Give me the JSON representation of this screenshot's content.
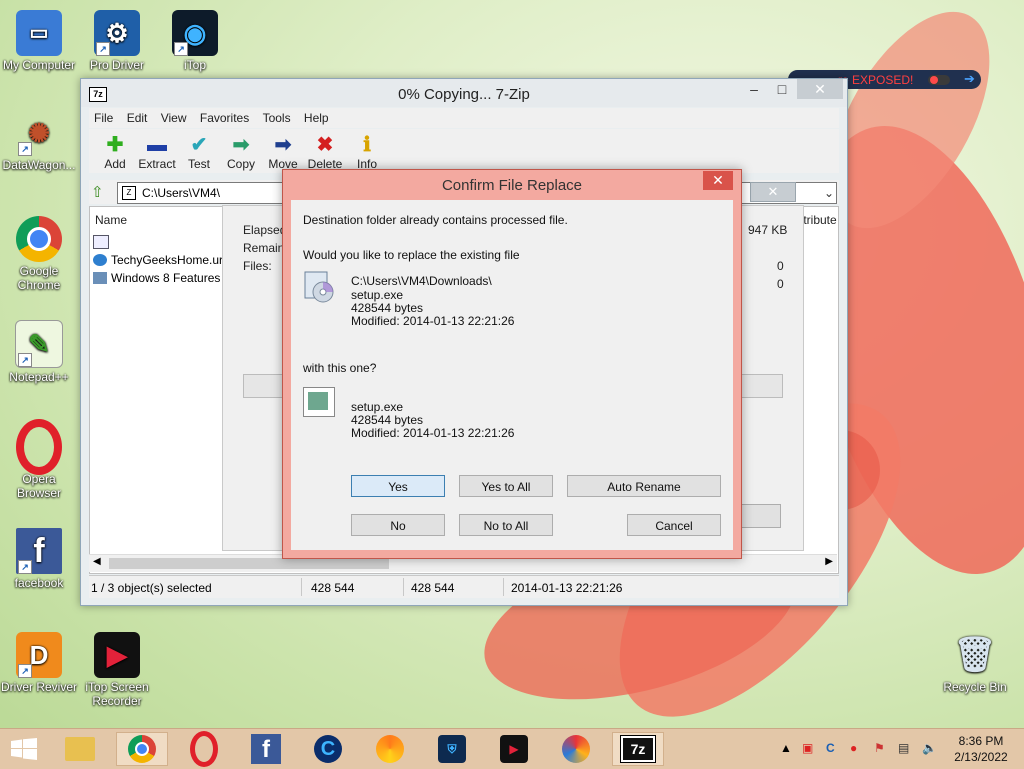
{
  "desktop": {
    "icons": [
      {
        "label": "My Computer"
      },
      {
        "label": "Pro Driver"
      },
      {
        "label": "iTop"
      },
      {
        "label": "DataWagon..."
      },
      {
        "label": "Google Chrome"
      },
      {
        "label": "Notepad++"
      },
      {
        "label": "Opera Browser"
      },
      {
        "label": "facebook"
      },
      {
        "label": "Driver Reviver"
      },
      {
        "label": "iTop Screen Recorder"
      },
      {
        "label": "Recycle Bin"
      }
    ]
  },
  "overlay": {
    "text": "re EXPOSED!"
  },
  "zip_window": {
    "title": "0% Copying... 7-Zip",
    "app_icon": "7z",
    "menu": [
      "File",
      "Edit",
      "View",
      "Favorites",
      "Tools",
      "Help"
    ],
    "toolbar": [
      {
        "label": "Add",
        "icon": "plus-icon",
        "color": "#2fae1f"
      },
      {
        "label": "Extract",
        "icon": "minus-icon",
        "color": "#1f3fa6"
      },
      {
        "label": "Test",
        "icon": "check-icon",
        "color": "#2aa6b8"
      },
      {
        "label": "Copy",
        "icon": "copy-arrow-icon",
        "color": "#2a9c6a"
      },
      {
        "label": "Move",
        "icon": "move-arrow-icon",
        "color": "#1f3f8f"
      },
      {
        "label": "Delete",
        "icon": "x-icon",
        "color": "#d42020"
      },
      {
        "label": "Info",
        "icon": "info-icon",
        "color": "#d8a400"
      }
    ],
    "address": "C:\\Users\\VM4\\",
    "columns": {
      "name": "Name",
      "attributes": "ttribute"
    },
    "files": [
      "",
      "TechyGeeksHome.url",
      "Windows 8 Features F"
    ],
    "status": {
      "selected": "1 / 3 object(s) selected",
      "size": "428 544",
      "packed": "428 544",
      "modified": "2014-01-13 22:21:26"
    }
  },
  "progress": {
    "elapsed_label": "Elapsed",
    "remaining_label": "Remainin",
    "files_label": "Files:",
    "size_value": "947 KB",
    "val1": "0",
    "val2": "0"
  },
  "confirm": {
    "title": "Confirm File Replace",
    "message": "Destination folder already contains processed file.",
    "question": "Would you like to replace the existing file",
    "existing": {
      "path": "C:\\Users\\VM4\\Downloads\\",
      "name": "setup.exe",
      "size": "428544 bytes",
      "modified": "Modified: 2014-01-13 22:21:26"
    },
    "with_this": "with this one?",
    "new": {
      "name": "setup.exe",
      "size": "428544 bytes",
      "modified": "Modified: 2014-01-13 22:21:26"
    },
    "buttons": {
      "yes": "Yes",
      "yes_to_all": "Yes to All",
      "auto_rename": "Auto Rename",
      "no": "No",
      "no_to_all": "No to All",
      "cancel": "Cancel"
    }
  },
  "taskbar": {
    "clock_time": "8:36 PM",
    "clock_date": "2/13/2022",
    "active_app": "7z"
  }
}
